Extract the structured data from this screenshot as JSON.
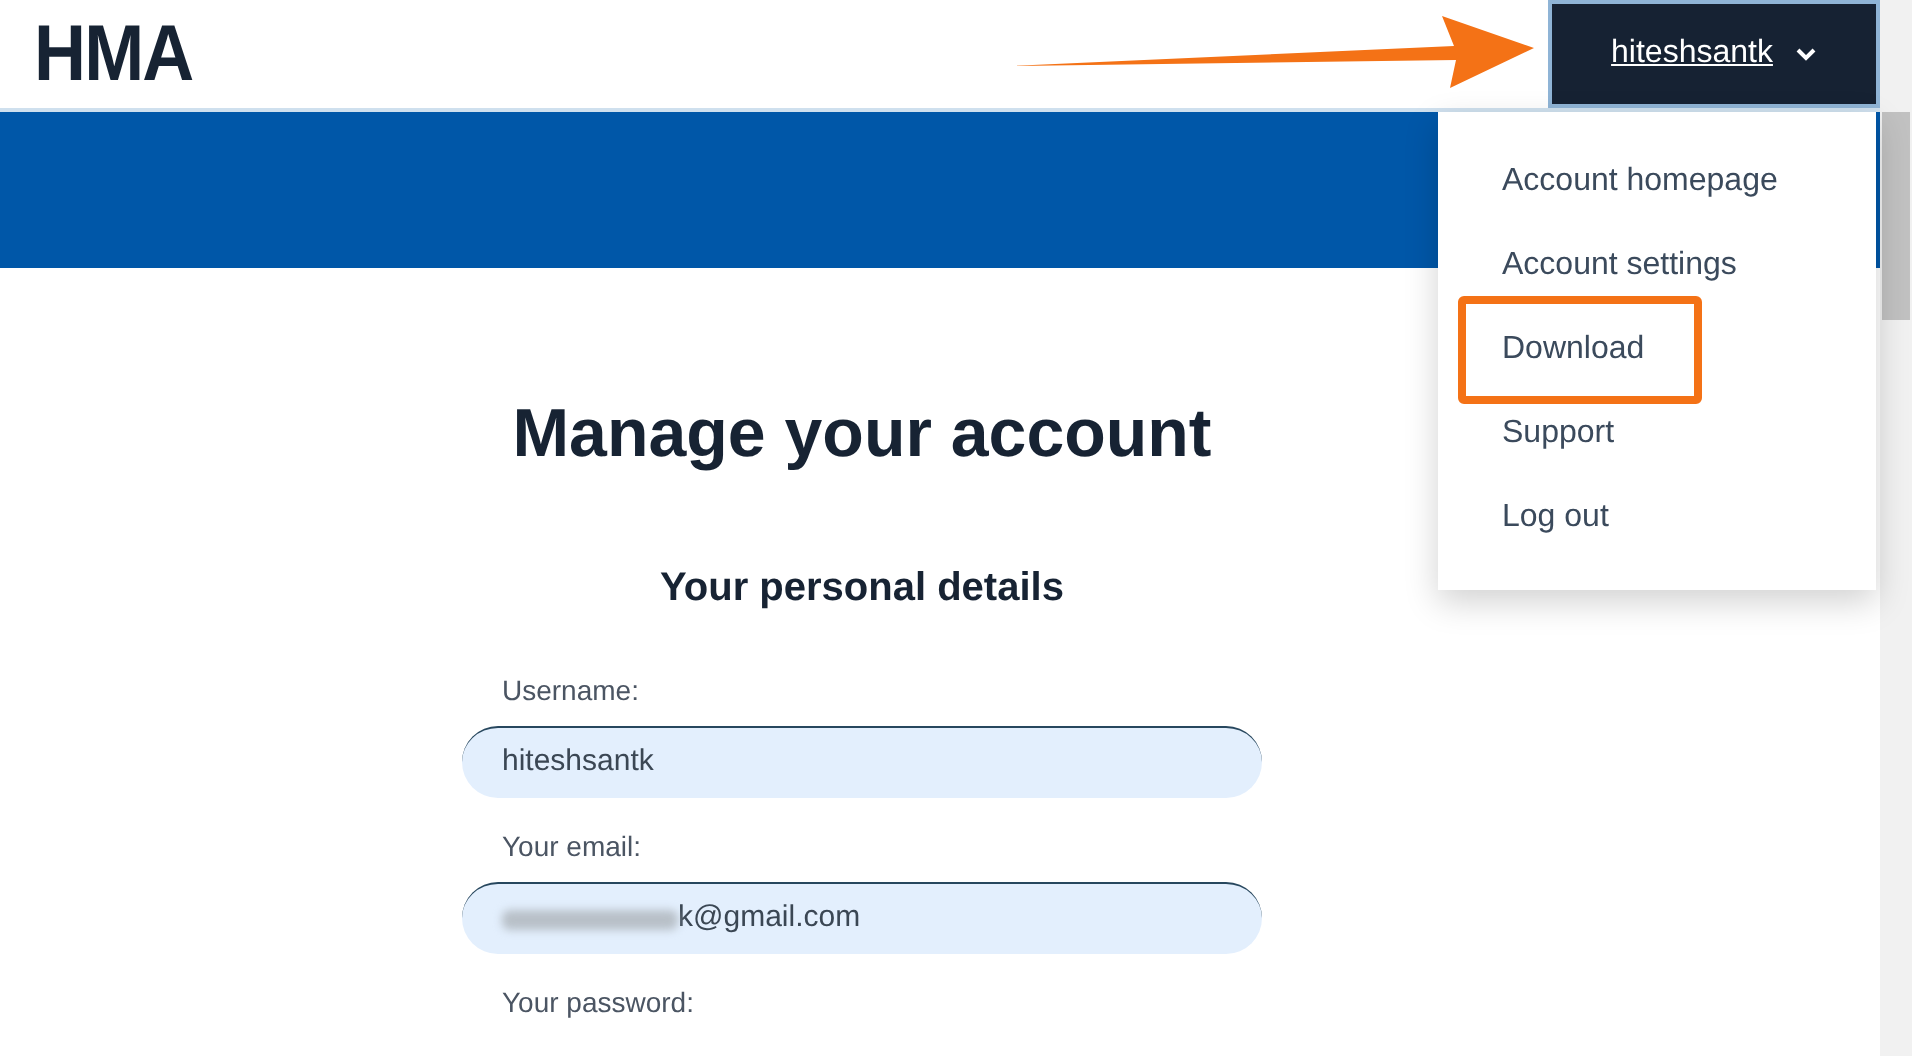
{
  "logo": "HMA",
  "account_button": {
    "label": "hiteshsantk",
    "expanded": true
  },
  "pointer_arrow": true,
  "menu": [
    {
      "label": "Account homepage",
      "highlighted": false
    },
    {
      "label": "Account settings",
      "highlighted": false
    },
    {
      "label": "Download",
      "highlighted": true
    },
    {
      "label": "Support",
      "highlighted": false
    },
    {
      "label": "Log out",
      "highlighted": false
    }
  ],
  "title": "Manage your account",
  "section_title": "Your personal details",
  "fields": [
    {
      "label": "Username:",
      "value": "hiteshsantk",
      "blurred": false
    },
    {
      "label": "Your email:",
      "value": "k@gmail.com",
      "blurred": true
    },
    {
      "label": "Your password:"
    }
  ]
}
